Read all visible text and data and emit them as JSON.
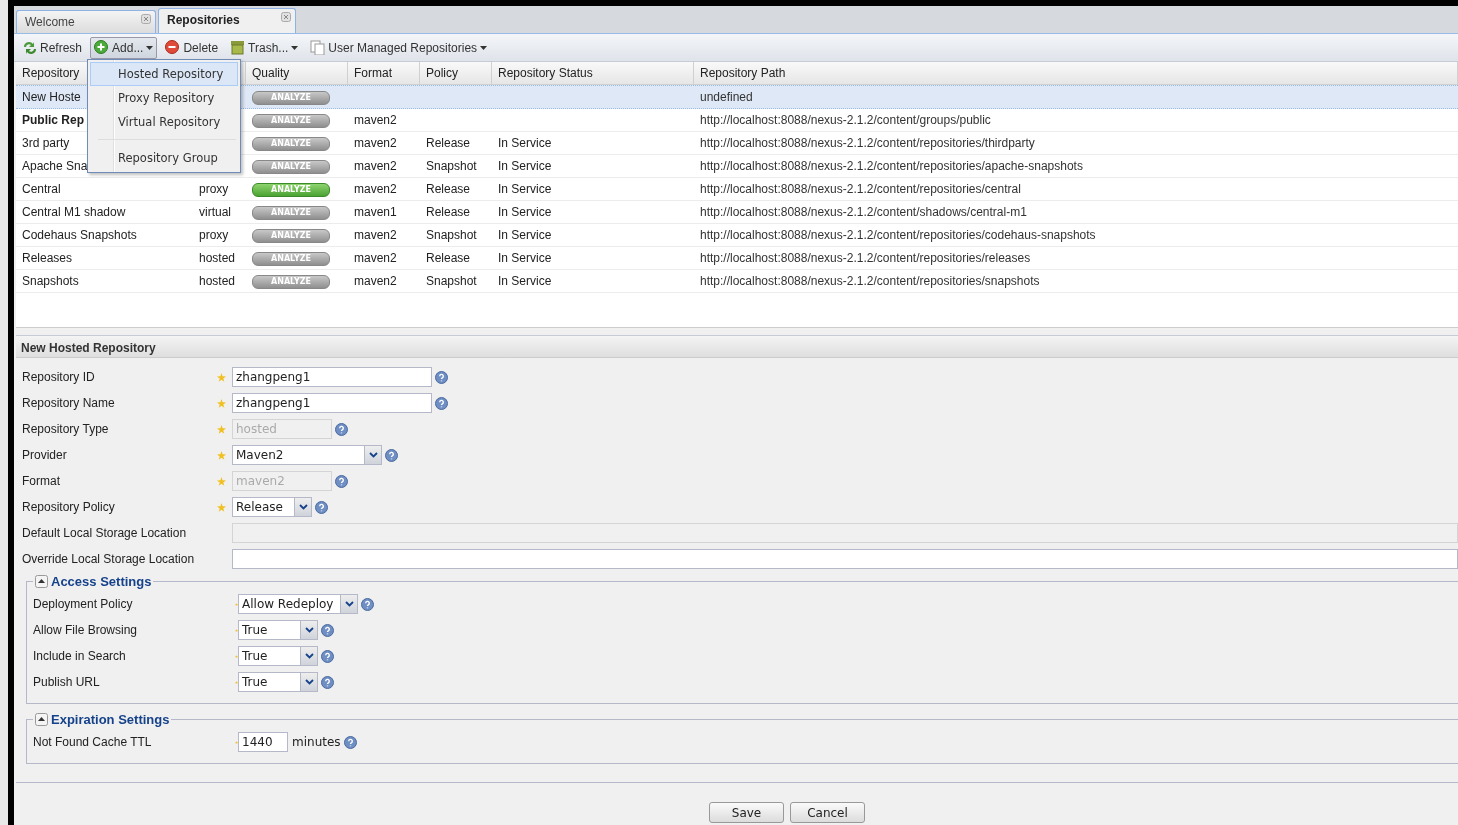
{
  "tabs": [
    {
      "label": "Welcome",
      "selected": false
    },
    {
      "label": "Repositories",
      "selected": true
    }
  ],
  "toolbar": [
    {
      "label": "Refresh",
      "kind": "refresh",
      "pressed": false,
      "dropdown": false
    },
    {
      "label": "Add...",
      "kind": "add",
      "pressed": true,
      "dropdown": true
    },
    {
      "label": "Delete",
      "kind": "delete",
      "pressed": false,
      "dropdown": false
    },
    {
      "label": "Trash...",
      "kind": "trash",
      "pressed": false,
      "dropdown": true
    },
    {
      "label": "User Managed Repositories",
      "kind": "pages",
      "pressed": false,
      "dropdown": true
    }
  ],
  "add_menu": [
    {
      "label": "Hosted Repository",
      "selected": true,
      "separator_before": false
    },
    {
      "label": "Proxy Repository",
      "selected": false,
      "separator_before": false
    },
    {
      "label": "Virtual Repository",
      "selected": false,
      "separator_before": false
    },
    {
      "label": "Repository Group",
      "selected": false,
      "separator_before": true
    }
  ],
  "table": {
    "columns": [
      "Repository",
      "Quality",
      "Format",
      "Policy",
      "Repository Status",
      "Repository Path"
    ],
    "rows": [
      {
        "name": "New Hoste",
        "quality": "ANALYZE",
        "quality_active": false,
        "path": "undefined",
        "selected": true,
        "bold": false
      },
      {
        "name": "Public Rep",
        "quality": "ANALYZE",
        "quality_active": false,
        "format": "maven2",
        "path": "http://localhost:8088/nexus-2.1.2/content/groups/public",
        "selected": false,
        "bold": true
      },
      {
        "name": "3rd party",
        "quality": "ANALYZE",
        "quality_active": false,
        "format": "maven2",
        "policy": "Release",
        "status": "In Service",
        "path": "http://localhost:8088/nexus-2.1.2/content/repositories/thirdparty",
        "selected": false,
        "bold": false
      },
      {
        "name": "Apache Sna",
        "quality": "ANALYZE",
        "quality_active": false,
        "format": "maven2",
        "policy": "Snapshot",
        "status": "In Service",
        "path": "http://localhost:8088/nexus-2.1.2/content/repositories/apache-snapshots",
        "selected": false,
        "bold": false
      },
      {
        "name": "Central",
        "type": "proxy",
        "quality": "ANALYZE",
        "quality_active": true,
        "format": "maven2",
        "policy": "Release",
        "status": "In Service",
        "path": "http://localhost:8088/nexus-2.1.2/content/repositories/central",
        "selected": false,
        "bold": false
      },
      {
        "name": "Central M1 shadow",
        "type": "virtual",
        "quality": "ANALYZE",
        "quality_active": false,
        "format": "maven1",
        "policy": "Release",
        "status": "In Service",
        "path": "http://localhost:8088/nexus-2.1.2/content/shadows/central-m1",
        "selected": false,
        "bold": false
      },
      {
        "name": "Codehaus Snapshots",
        "type": "proxy",
        "quality": "ANALYZE",
        "quality_active": false,
        "format": "maven2",
        "policy": "Snapshot",
        "status": "In Service",
        "path": "http://localhost:8088/nexus-2.1.2/content/repositories/codehaus-snapshots",
        "selected": false,
        "bold": false
      },
      {
        "name": "Releases",
        "type": "hosted",
        "quality": "ANALYZE",
        "quality_active": false,
        "format": "maven2",
        "policy": "Release",
        "status": "In Service",
        "path": "http://localhost:8088/nexus-2.1.2/content/repositories/releases",
        "selected": false,
        "bold": false
      },
      {
        "name": "Snapshots",
        "type": "hosted",
        "quality": "ANALYZE",
        "quality_active": false,
        "format": "maven2",
        "policy": "Snapshot",
        "status": "In Service",
        "path": "http://localhost:8088/nexus-2.1.2/content/repositories/snapshots",
        "selected": false,
        "bold": false
      }
    ]
  },
  "form": {
    "title": "New Hosted Repository",
    "fields": [
      {
        "label": "Repository ID",
        "kind": "text",
        "value": "zhangpeng1",
        "required": true,
        "disabled": false,
        "help": true
      },
      {
        "label": "Repository Name",
        "kind": "text",
        "value": "zhangpeng1",
        "required": true,
        "disabled": false,
        "help": true
      },
      {
        "label": "Repository Type",
        "kind": "short",
        "value": "hosted",
        "required": true,
        "disabled": true,
        "help": true
      },
      {
        "label": "Provider",
        "kind": "combo",
        "value": "Maven2",
        "required": true,
        "disabled": false,
        "help": true
      },
      {
        "label": "Format",
        "kind": "short",
        "value": "maven2",
        "required": true,
        "disabled": true,
        "help": true
      },
      {
        "label": "Repository Policy",
        "kind": "combo-small",
        "value": "Release",
        "required": true,
        "disabled": false,
        "help": true
      },
      {
        "label": "Default Local Storage Location",
        "kind": "wide",
        "required": false,
        "disabled": true,
        "help": false
      },
      {
        "label": "Override Local Storage Location",
        "kind": "wide",
        "required": false,
        "disabled": false,
        "help": false
      }
    ],
    "sections": [
      {
        "title": "Access Settings",
        "expanded": true,
        "fields": [
          {
            "label": "Deployment Policy",
            "kind": "combo-mid",
            "value": "Allow Redeploy",
            "required": true,
            "disabled": false,
            "help": true
          },
          {
            "label": "Allow File Browsing",
            "kind": "combo-small",
            "value": "True",
            "required": true,
            "disabled": false,
            "help": true
          },
          {
            "label": "Include in Search",
            "kind": "combo-small",
            "value": "True",
            "required": true,
            "disabled": false,
            "help": true
          },
          {
            "label": "Publish URL",
            "kind": "combo-small",
            "value": "True",
            "required": true,
            "disabled": false,
            "help": true
          }
        ]
      },
      {
        "title": "Expiration Settings",
        "expanded": true,
        "fields": [
          {
            "label": "Not Found Cache TTL",
            "kind": "number",
            "value": "1440",
            "unit": "minutes",
            "required": true,
            "disabled": false,
            "help": true
          }
        ]
      }
    ],
    "buttons": [
      "Save",
      "Cancel"
    ]
  }
}
